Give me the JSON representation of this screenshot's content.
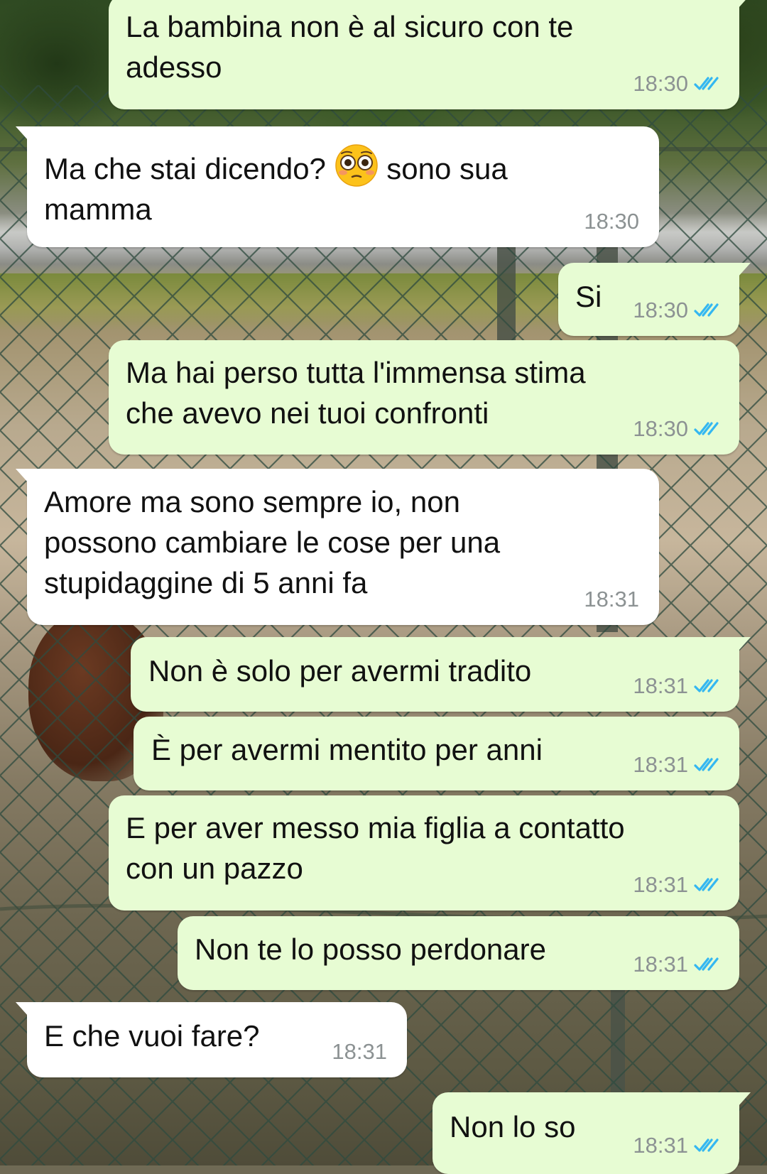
{
  "theme": {
    "outgoing_bubble": "#e7fcd3",
    "incoming_bubble": "#ffffff",
    "read_tick_color": "#34b7f1",
    "time_color": "#8c9293"
  },
  "messages": [
    {
      "dir": "out",
      "text": "La bambina non è al sicuro con te\nadesso",
      "time": "18:30",
      "status": "read-double-tick-icon"
    },
    {
      "dir": "in",
      "text_before": "Ma che stai dicendo? ",
      "emoji": "flushed-face-emoji",
      "text_after": " sono sua\nmamma",
      "time": "18:30"
    },
    {
      "dir": "out",
      "text": "Si",
      "time": "18:30",
      "status": "read-double-tick-icon"
    },
    {
      "dir": "out",
      "text": "Ma hai perso tutta l'immensa stima\nche avevo nei tuoi confronti",
      "time": "18:30",
      "status": "read-double-tick-icon"
    },
    {
      "dir": "in",
      "text": "Amore ma sono sempre io, non\npossono cambiare le cose per una\nstupidaggine di 5 anni fa",
      "time": "18:31"
    },
    {
      "dir": "out",
      "text": "Non è solo per avermi tradito",
      "time": "18:31",
      "status": "read-double-tick-icon"
    },
    {
      "dir": "out",
      "text": "È per avermi mentito per anni",
      "time": "18:31",
      "status": "read-double-tick-icon"
    },
    {
      "dir": "out",
      "text": "E per aver messo mia figlia a contatto\ncon un pazzo",
      "time": "18:31",
      "status": "read-double-tick-icon"
    },
    {
      "dir": "out",
      "text": "Non te lo posso perdonare",
      "time": "18:31",
      "status": "read-double-tick-icon"
    },
    {
      "dir": "in",
      "text": "E che vuoi fare?",
      "time": "18:31"
    },
    {
      "dir": "out",
      "text": "Non lo so",
      "time": "18:31",
      "status": "read-double-tick-icon"
    }
  ]
}
